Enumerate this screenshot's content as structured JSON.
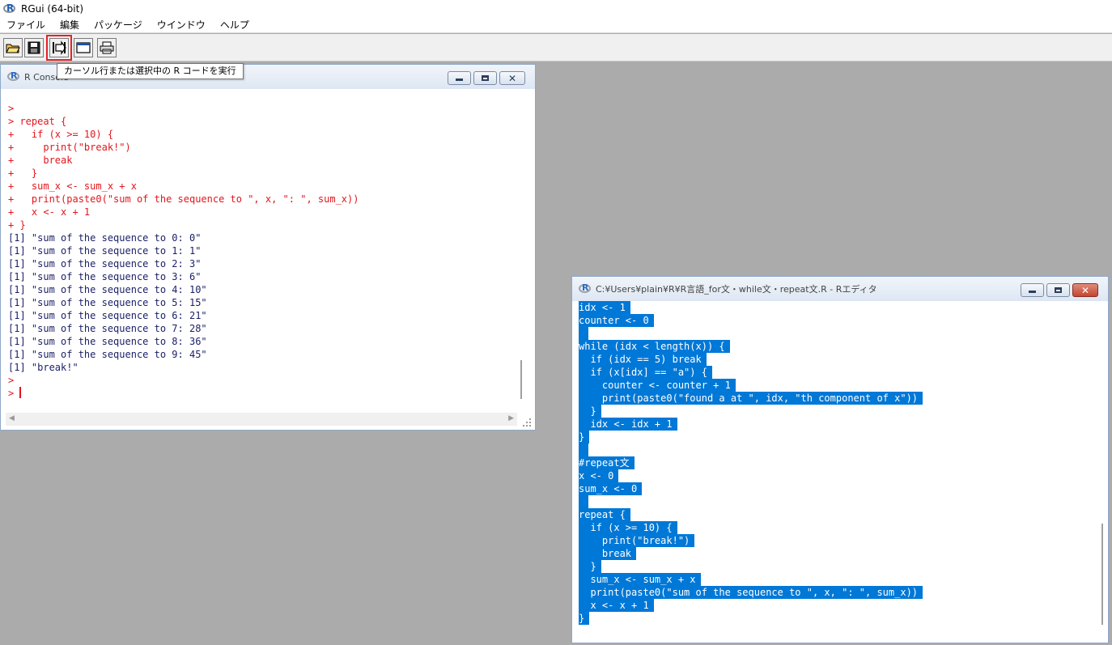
{
  "app": {
    "title": "RGui (64-bit)"
  },
  "menu": [
    "ファイル",
    "編集",
    "パッケージ",
    "ウインドウ",
    "ヘルプ"
  ],
  "toolbar": {
    "buttons": [
      {
        "name": "open-script-icon"
      },
      {
        "name": "save-icon"
      },
      {
        "name": "run-line-icon"
      },
      {
        "name": "console-window-icon"
      },
      {
        "name": "print-icon"
      }
    ],
    "tooltip": "カーソル行または選択中の R コードを実行"
  },
  "console": {
    "title": "R Console",
    "lines": [
      {
        "text": ">",
        "color": "red"
      },
      {
        "text": "> repeat {",
        "color": "red"
      },
      {
        "text": "+   if (x >= 10) {",
        "color": "red"
      },
      {
        "text": "+     print(\"break!\")",
        "color": "red"
      },
      {
        "text": "+     break",
        "color": "red"
      },
      {
        "text": "+   }",
        "color": "red"
      },
      {
        "text": "+   sum_x <- sum_x + x",
        "color": "red"
      },
      {
        "text": "+   print(paste0(\"sum of the sequence to \", x, \": \", sum_x))",
        "color": "red"
      },
      {
        "text": "+   x <- x + 1",
        "color": "red"
      },
      {
        "text": "+ }",
        "color": "red"
      },
      {
        "text": "[1] \"sum of the sequence to 0: 0\"",
        "color": "navy"
      },
      {
        "text": "[1] \"sum of the sequence to 1: 1\"",
        "color": "navy"
      },
      {
        "text": "[1] \"sum of the sequence to 2: 3\"",
        "color": "navy"
      },
      {
        "text": "[1] \"sum of the sequence to 3: 6\"",
        "color": "navy"
      },
      {
        "text": "[1] \"sum of the sequence to 4: 10\"",
        "color": "navy"
      },
      {
        "text": "[1] \"sum of the sequence to 5: 15\"",
        "color": "navy"
      },
      {
        "text": "[1] \"sum of the sequence to 6: 21\"",
        "color": "navy"
      },
      {
        "text": "[1] \"sum of the sequence to 7: 28\"",
        "color": "navy"
      },
      {
        "text": "[1] \"sum of the sequence to 8: 36\"",
        "color": "navy"
      },
      {
        "text": "[1] \"sum of the sequence to 9: 45\"",
        "color": "navy"
      },
      {
        "text": "[1] \"break!\"",
        "color": "navy"
      },
      {
        "text": ">",
        "color": "red"
      }
    ],
    "prompt": "> "
  },
  "editor": {
    "title": "C:¥Users¥plain¥R¥R言語_for文・while文・repeat文.R - Rエディタ",
    "lines": [
      "idx <- 1",
      "counter <- 0",
      "",
      "while (idx < length(x)) {",
      "  if (idx == 5) break",
      "  if (x[idx] == \"a\") {",
      "    counter <- counter + 1",
      "    print(paste0(\"found a at \", idx, \"th component of x\"))",
      "  }",
      "  idx <- idx + 1",
      "}",
      "",
      "#repeat文",
      "x <- 0",
      "sum_x <- 0",
      "",
      "repeat {",
      "  if (x >= 10) {",
      "    print(\"break!\")",
      "    break",
      "  }",
      "  sum_x <- sum_x + x",
      "  print(paste0(\"sum of the sequence to \", x, \": \", sum_x))",
      "  x <- x + 1",
      "}"
    ]
  },
  "colors": {
    "input_text": "#e3151c",
    "output_text": "#1a1f66",
    "selection": "#0078d7",
    "mdi_background": "#ababab",
    "highlight_box": "#e3232a"
  }
}
